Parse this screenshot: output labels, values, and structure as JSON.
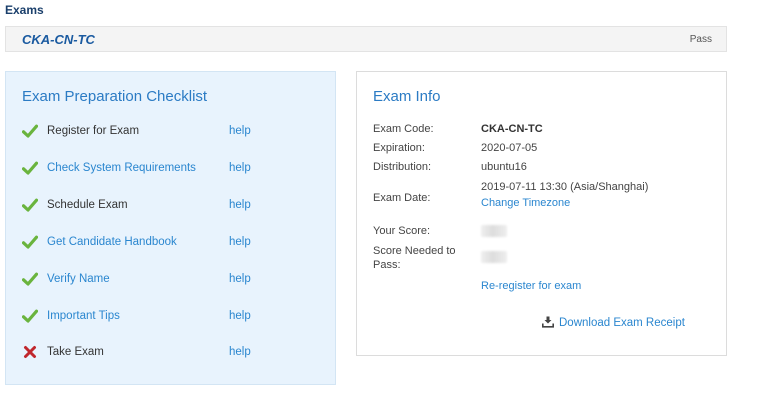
{
  "page": {
    "section_title": "Exams"
  },
  "exam": {
    "code": "CKA-CN-TC",
    "status": "Pass"
  },
  "checklist": {
    "title": "Exam Preparation Checklist",
    "help_label": "help",
    "items": [
      {
        "label": "Register for Exam",
        "status": "done",
        "is_link": false
      },
      {
        "label": "Check System Requirements",
        "status": "done",
        "is_link": true
      },
      {
        "label": "Schedule Exam",
        "status": "done",
        "is_link": false
      },
      {
        "label": "Get Candidate Handbook",
        "status": "done",
        "is_link": true
      },
      {
        "label": "Verify Name",
        "status": "done",
        "is_link": true
      },
      {
        "label": "Important Tips",
        "status": "done",
        "is_link": true
      },
      {
        "label": "Take Exam",
        "status": "failed",
        "is_link": false
      }
    ]
  },
  "exam_info": {
    "title": "Exam Info",
    "exam_code_label": "Exam Code:",
    "exam_code": "CKA-CN-TC",
    "expiration_label": "Expiration:",
    "expiration": "2020-07-05",
    "distribution_label": "Distribution:",
    "distribution": "ubuntu16",
    "exam_date_label": "Exam Date:",
    "exam_date": "2019-07-11 13:30 (Asia/Shanghai)",
    "change_timezone": "Change Timezone",
    "your_score_label": "Your Score:",
    "score_needed_label": "Score Needed to Pass:",
    "reregister": "Re-register for exam",
    "download_receipt": "Download Exam Receipt"
  },
  "colors": {
    "check_green": "#6ab43e",
    "cross_red": "#c0272d",
    "link_blue": "#2a86cf",
    "title_blue": "#2b7bc4"
  },
  "icons": {
    "done": "check-icon",
    "failed": "cross-icon",
    "download": "download-icon"
  }
}
